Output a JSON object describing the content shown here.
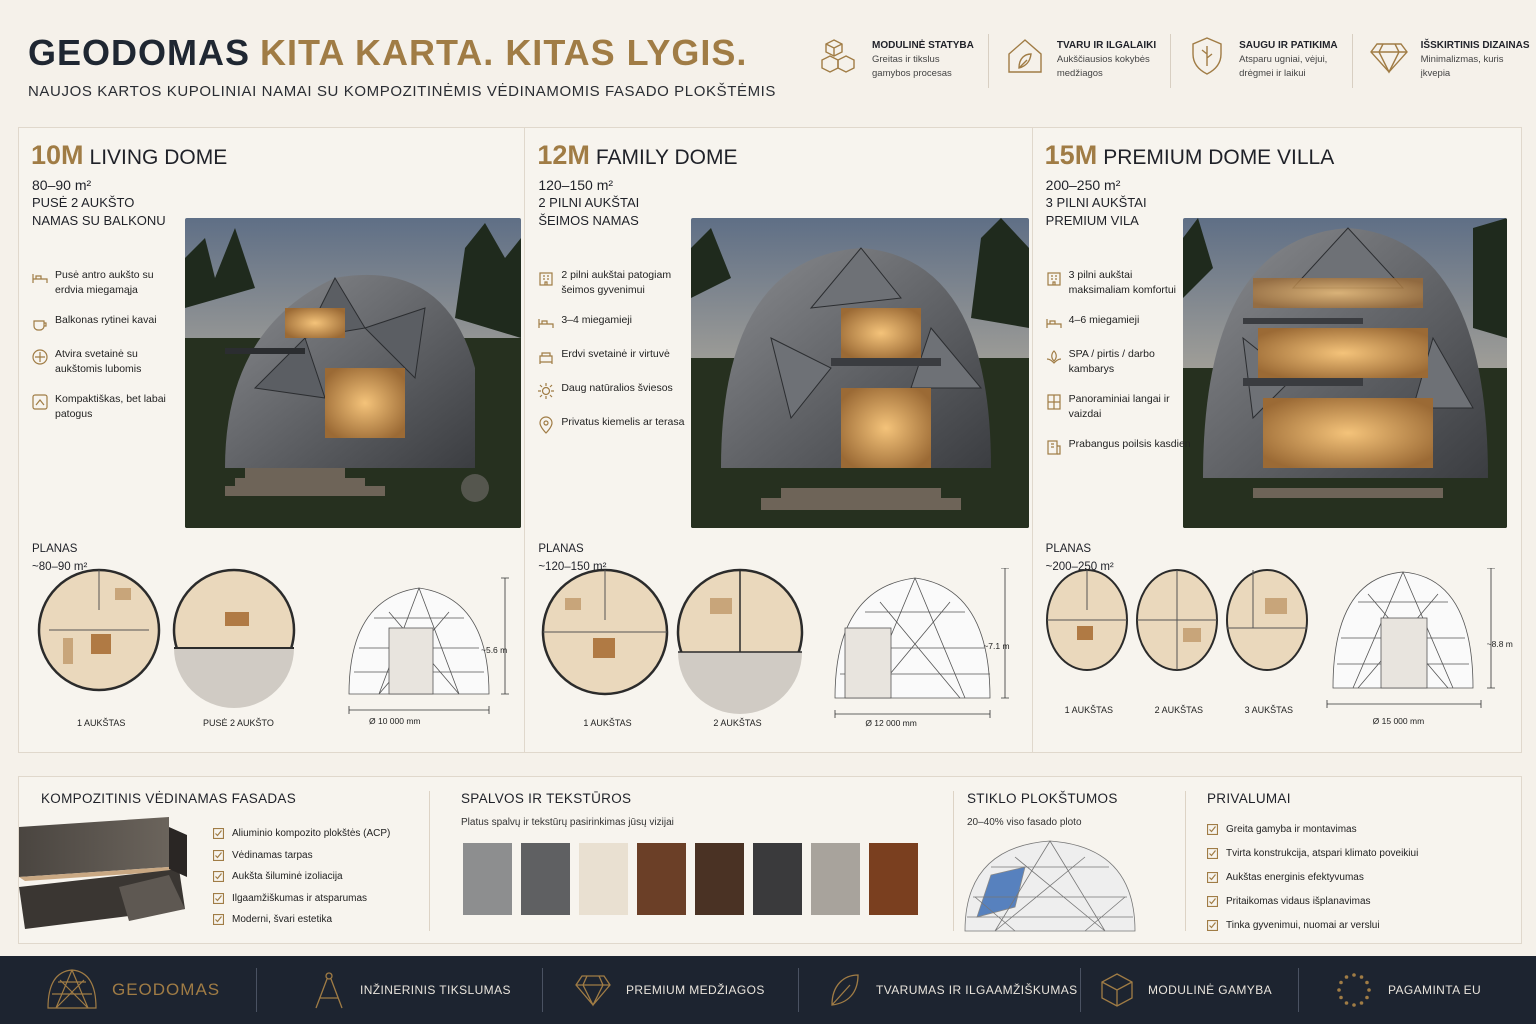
{
  "header": {
    "brand": "GEODOMAS",
    "tagline": "KITA KARTA. KITAS LYGIS.",
    "subtitle": "NAUJOS KARTOS KUPOLINIAI NAMAI SU KOMPOZITINĖMIS VĖDINAMOMIS FASADO PLOKŠTĖMIS",
    "features": [
      {
        "icon": "cubes-icon",
        "title": "MODULINĖ STATYBA",
        "desc": "Greitas ir tikslus gamybos procesas"
      },
      {
        "icon": "leaf-house-icon",
        "title": "TVARU IR ILGALAIKI",
        "desc": "Aukščiausios kokybės medžiagos"
      },
      {
        "icon": "shield-icon",
        "title": "SAUGU IR PATIKIMA",
        "desc": "Atsparu ugniai, vėjui, drėgmei ir laikui"
      },
      {
        "icon": "diamond-icon",
        "title": "IŠSKIRTINIS DIZAINAS",
        "desc": "Minimalizmas, kuris įkvepia"
      }
    ]
  },
  "models": [
    {
      "size": "10M",
      "name": "LIVING DOME",
      "area": "80–90 m²",
      "line1": "PUSĖ 2 AUKŠTO",
      "line2": "NAMAS SU BALKONU",
      "features": [
        {
          "icon": "bed-icon",
          "text": "Pusė antro aukšto su erdvia miegamąja"
        },
        {
          "icon": "coffee-icon",
          "text": "Balkonas rytinei kavai"
        },
        {
          "icon": "arrows-icon",
          "text": "Atvira svetainė su aukštomis lubomis"
        },
        {
          "icon": "hand-house-icon",
          "text": "Kompaktiškas, bet labai patogus"
        }
      ],
      "plan_title": "PLANAS",
      "plan_area": "~80–90 m²",
      "floor_labels": [
        "1 AUKŠTAS",
        "PUSĖ 2 AUKŠTO"
      ],
      "height": "~5.6 m",
      "diameter": "Ø 10 000 mm"
    },
    {
      "size": "12M",
      "name": "FAMILY DOME",
      "area": "120–150 m²",
      "line1": "2 PILNI AUKŠTAI",
      "line2": "ŠEIMOS NAMAS",
      "features": [
        {
          "icon": "building-icon",
          "text": "2 pilni aukštai patogiam šeimos gyvenimui"
        },
        {
          "icon": "bed-icon",
          "text": "3–4 miegamieji"
        },
        {
          "icon": "sofa-icon",
          "text": "Erdvi svetainė ir virtuvė"
        },
        {
          "icon": "sun-icon",
          "text": "Daug natūralios šviesos"
        },
        {
          "icon": "pin-icon",
          "text": "Privatus kiemelis ar terasa"
        }
      ],
      "plan_title": "PLANAS",
      "plan_area": "~120–150 m²",
      "floor_labels": [
        "1 AUKŠTAS",
        "2 AUKŠTAS"
      ],
      "height": "~7.1 m",
      "diameter": "Ø 12 000 mm"
    },
    {
      "size": "15M",
      "name": "PREMIUM DOME VILLA",
      "area": "200–250 m²",
      "line1": "3 PILNI AUKŠTAI",
      "line2": "PREMIUM VILA",
      "features": [
        {
          "icon": "building-icon",
          "text": "3 pilni aukštai maksimaliam komfortui"
        },
        {
          "icon": "bed-icon",
          "text": "4–6 miegamieji"
        },
        {
          "icon": "spa-icon",
          "text": "SPA / pirtis / darbo kambarys"
        },
        {
          "icon": "window-icon",
          "text": "Panoraminiai langai ir vaizdai"
        },
        {
          "icon": "luxury-icon",
          "text": "Prabangus poilsis kasdien"
        }
      ],
      "plan_title": "PLANAS",
      "plan_area": "~200–250 m²",
      "floor_labels": [
        "1 AUKŠTAS",
        "2 AUKŠTAS",
        "3 AUKŠTAS"
      ],
      "height": "~8.8 m",
      "diameter": "Ø 15 000 mm"
    }
  ],
  "bottom": {
    "facade": {
      "title": "KOMPOZITINIS VĖDINAMAS FASADAS",
      "items": [
        "Aliuminio kompozito plokštės (ACP)",
        "Vėdinamas tarpas",
        "Aukšta šiluminė izoliacija",
        "Ilgaamžiškumas ir atsparumas",
        "Moderni, švari estetika"
      ]
    },
    "colors": {
      "title": "SPALVOS IR TEKSTŪROS",
      "sub": "Platus spalvų ir tekstūrų pasirinkimas jūsų vizijai",
      "swatches": [
        "#8d8e8f",
        "#5f6062",
        "#e9e0d1",
        "#6b3f27",
        "#4a3224",
        "#3a3a3c",
        "#a8a39c",
        "#7a3f1f"
      ]
    },
    "glass": {
      "title": "STIKLO PLOKŠTUMOS",
      "sub": "20–40% viso fasado ploto"
    },
    "advantages": {
      "title": "PRIVALUMAI",
      "items": [
        "Greita gamyba ir montavimas",
        "Tvirta konstrukcija, atspari klimato poveikiui",
        "Aukštas energinis efektyvumas",
        "Pritaikomas vidaus išplanavimas",
        "Tinka gyvenimui, nuomai ar verslui"
      ]
    }
  },
  "footer": [
    {
      "icon": "dome-logo-icon",
      "label": "GEODOMAS"
    },
    {
      "icon": "compass-icon",
      "label": "INŽINERINIS TIKSLUMAS"
    },
    {
      "icon": "diamond-icon",
      "label": "PREMIUM MEDŽIAGOS"
    },
    {
      "icon": "leaf-icon",
      "label": "TVARUMAS IR ILGAAMŽIŠKUMAS"
    },
    {
      "icon": "cube-icon",
      "label": "MODULINĖ GAMYBA"
    },
    {
      "icon": "eu-stars-icon",
      "label": "PAGAMINTA EU"
    }
  ],
  "colors": {
    "accent": "#a07c45",
    "dark": "#1d2430",
    "background": "#f5f1ea"
  }
}
